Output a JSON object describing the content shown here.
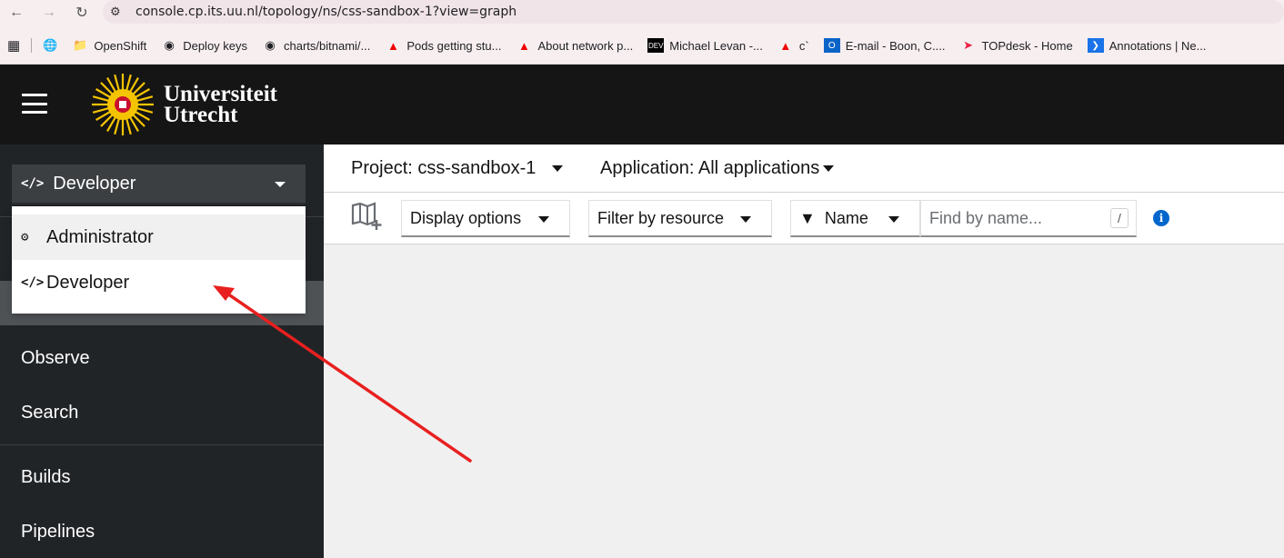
{
  "browser": {
    "url": "console.cp.its.uu.nl/topology/ns/css-sandbox-1?view=graph",
    "bookmarks": [
      {
        "label": "OpenShift",
        "icon": "folder-icon"
      },
      {
        "label": "Deploy keys",
        "icon": "github-icon"
      },
      {
        "label": "charts/bitnami/...",
        "icon": "github-icon"
      },
      {
        "label": "Pods getting stu...",
        "icon": "redhat-icon"
      },
      {
        "label": "About network p...",
        "icon": "redhat-icon"
      },
      {
        "label": "Michael Levan -...",
        "icon": "dev-icon"
      },
      {
        "label": "c`",
        "icon": "redhat-icon"
      },
      {
        "label": "E-mail - Boon, C....",
        "icon": "outlook-icon"
      },
      {
        "label": "TOPdesk - Home",
        "icon": "topdesk-icon"
      },
      {
        "label": "Annotations | Ne...",
        "icon": "kube-icon"
      }
    ]
  },
  "masthead": {
    "logo_line1": "Universiteit",
    "logo_line2": "Utrecht"
  },
  "sidebar": {
    "perspective": "Developer",
    "menu": [
      {
        "label": "Administrator",
        "icon": "cogs-icon"
      },
      {
        "label": "Developer",
        "icon": "code-icon"
      }
    ],
    "items": [
      "Observe",
      "Search",
      "Builds",
      "Pipelines"
    ]
  },
  "header": {
    "project": "Project: css-sandbox-1",
    "application": "Application: All applications"
  },
  "toolbar": {
    "display_options": "Display options",
    "filter_by_resource": "Filter by resource",
    "filter_name": "Name",
    "find_placeholder": "Find by name...",
    "shortcut_key": "/"
  },
  "annotation_color": "#e8201f"
}
